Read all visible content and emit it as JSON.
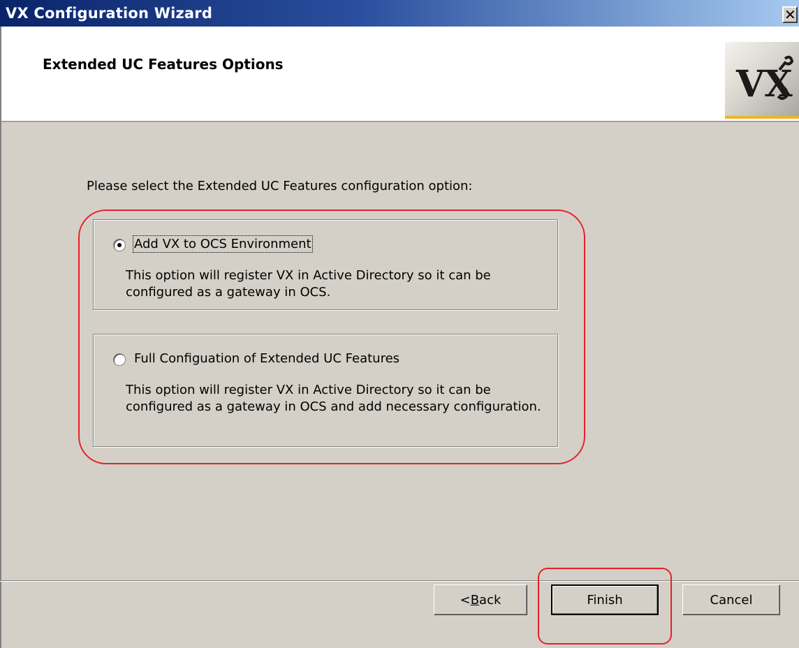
{
  "window": {
    "title": "VX Configuration Wizard",
    "close_glyph": "✕"
  },
  "header": {
    "page_title": "Extended UC Features Options",
    "logo_text": "VX"
  },
  "body": {
    "prompt": "Please select the Extended UC Features configuration option:",
    "options": [
      {
        "label": "Add VX to OCS Environment",
        "description": "This option will register VX in Active Directory so it can be configured as a gateway in OCS.",
        "selected": true
      },
      {
        "label": "Full Configuation of Extended UC Features",
        "description": "This option will register VX in Active Directory so it can be configured as a gateway in OCS and add necessary configuration.",
        "selected": false
      }
    ]
  },
  "buttons": {
    "back": "< Back",
    "finish": "Finish",
    "cancel": "Cancel"
  },
  "colors": {
    "highlight": "#e8202a",
    "titlebar_start": "#0a246a",
    "dialog_bg": "#d4d0c8"
  }
}
